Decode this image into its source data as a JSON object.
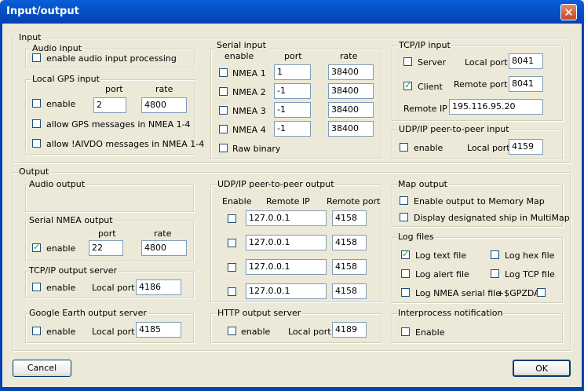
{
  "window": {
    "title": "Input/output",
    "close_glyph": "✕"
  },
  "input": {
    "legend": "Input",
    "audio": {
      "legend": "Audio input",
      "enable_label": "enable audio input processing",
      "enabled": false
    },
    "gps": {
      "legend": "Local GPS input",
      "port_header": "port",
      "rate_header": "rate",
      "enable_label": "enable",
      "enabled": false,
      "port": "2",
      "rate": "4800",
      "allow_gps_label": "allow GPS messages in NMEA 1-4",
      "allow_gps": false,
      "allow_aivdo_label": "allow !AIVDO messages in NMEA 1-4",
      "allow_aivdo": false
    },
    "serial": {
      "legend": "Serial input",
      "enable_header": "enable",
      "port_header": "port",
      "rate_header": "rate",
      "rows": [
        {
          "label": "NMEA 1",
          "enabled": false,
          "port": "1",
          "rate": "38400"
        },
        {
          "label": "NMEA 2",
          "enabled": false,
          "port": "-1",
          "rate": "38400"
        },
        {
          "label": "NMEA 3",
          "enabled": false,
          "port": "-1",
          "rate": "38400"
        },
        {
          "label": "NMEA 4",
          "enabled": false,
          "port": "-1",
          "rate": "38400"
        }
      ],
      "raw_label": "Raw binary",
      "raw": false
    },
    "tcpip": {
      "legend": "TCP/IP input",
      "server_label": "Server",
      "server": false,
      "local_port_label": "Local port",
      "local_port": "8041",
      "client_label": "Client",
      "client": true,
      "remote_port_label": "Remote port",
      "remote_port": "8041",
      "remote_ip_label": "Remote IP",
      "remote_ip": "195.116.95.20"
    },
    "udp": {
      "legend": "UDP/IP peer-to-peer input",
      "enable_label": "enable",
      "enabled": false,
      "local_port_label": "Local port",
      "local_port": "4159"
    }
  },
  "output": {
    "legend": "Output",
    "audio": {
      "legend": "Audio output"
    },
    "serial": {
      "legend": "Serial NMEA output",
      "port_header": "port",
      "rate_header": "rate",
      "enable_label": "enable",
      "enabled": true,
      "port": "22",
      "rate": "4800"
    },
    "tcp_server": {
      "legend": "TCP/IP output server",
      "enable_label": "enable",
      "enabled": false,
      "local_port_label": "Local port",
      "local_port": "4186"
    },
    "google": {
      "legend": "Google Earth output server",
      "enable_label": "enable",
      "enabled": false,
      "local_port_label": "Local port",
      "local_port": "4185"
    },
    "udp": {
      "legend": "UDP/IP peer-to-peer output",
      "enable_header": "Enable",
      "remote_ip_header": "Remote IP",
      "remote_port_header": "Remote port",
      "rows": [
        {
          "enabled": false,
          "ip": "127.0.0.1",
          "port": "4158"
        },
        {
          "enabled": false,
          "ip": "127.0.0.1",
          "port": "4158"
        },
        {
          "enabled": false,
          "ip": "127.0.0.1",
          "port": "4158"
        },
        {
          "enabled": false,
          "ip": "127.0.0.1",
          "port": "4158"
        }
      ]
    },
    "http": {
      "legend": "HTTP output server",
      "enable_label": "enable",
      "enabled": false,
      "local_port_label": "Local port",
      "local_port": "4189"
    },
    "map": {
      "legend": "Map output",
      "memory_label": "Enable output to Memory Map",
      "memory": false,
      "multimap_label": "Display designated ship in MultiMap",
      "multimap": false
    },
    "log": {
      "legend": "Log files",
      "text_label": "Log text file",
      "text": true,
      "hex_label": "Log hex file",
      "hex": false,
      "alert_label": "Log alert file",
      "alert": false,
      "tcp_label": "Log TCP file",
      "tcp": false,
      "nmea_label": "Log NMEA serial file",
      "nmea": false,
      "gpzda_label": "+$GPZDA",
      "gpzda": false
    },
    "ipc": {
      "legend": "Interprocess notification",
      "enable_label": "Enable",
      "enabled": false
    }
  },
  "buttons": {
    "cancel": "Cancel",
    "ok": "OK"
  }
}
